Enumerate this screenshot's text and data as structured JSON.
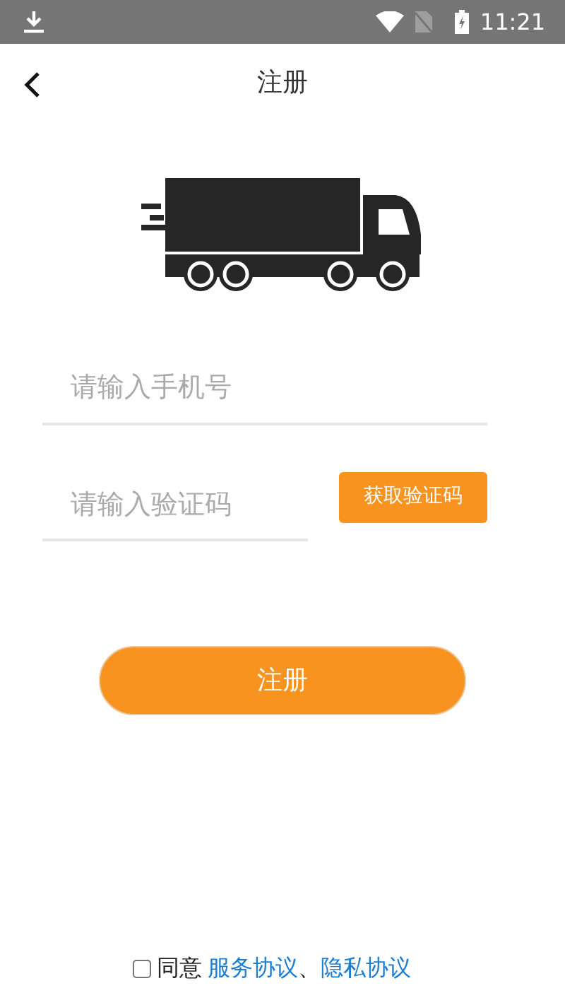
{
  "status_bar": {
    "time": "11:21"
  },
  "header": {
    "title": "注册"
  },
  "phone_field": {
    "placeholder": "请输入手机号"
  },
  "code_field": {
    "placeholder": "请输入验证码"
  },
  "get_code_button": "获取验证码",
  "submit_button": "注册",
  "agreement": {
    "checked": false,
    "prefix": "同意",
    "links": [
      "服务协议",
      "隐私协议"
    ],
    "separator": "、"
  }
}
